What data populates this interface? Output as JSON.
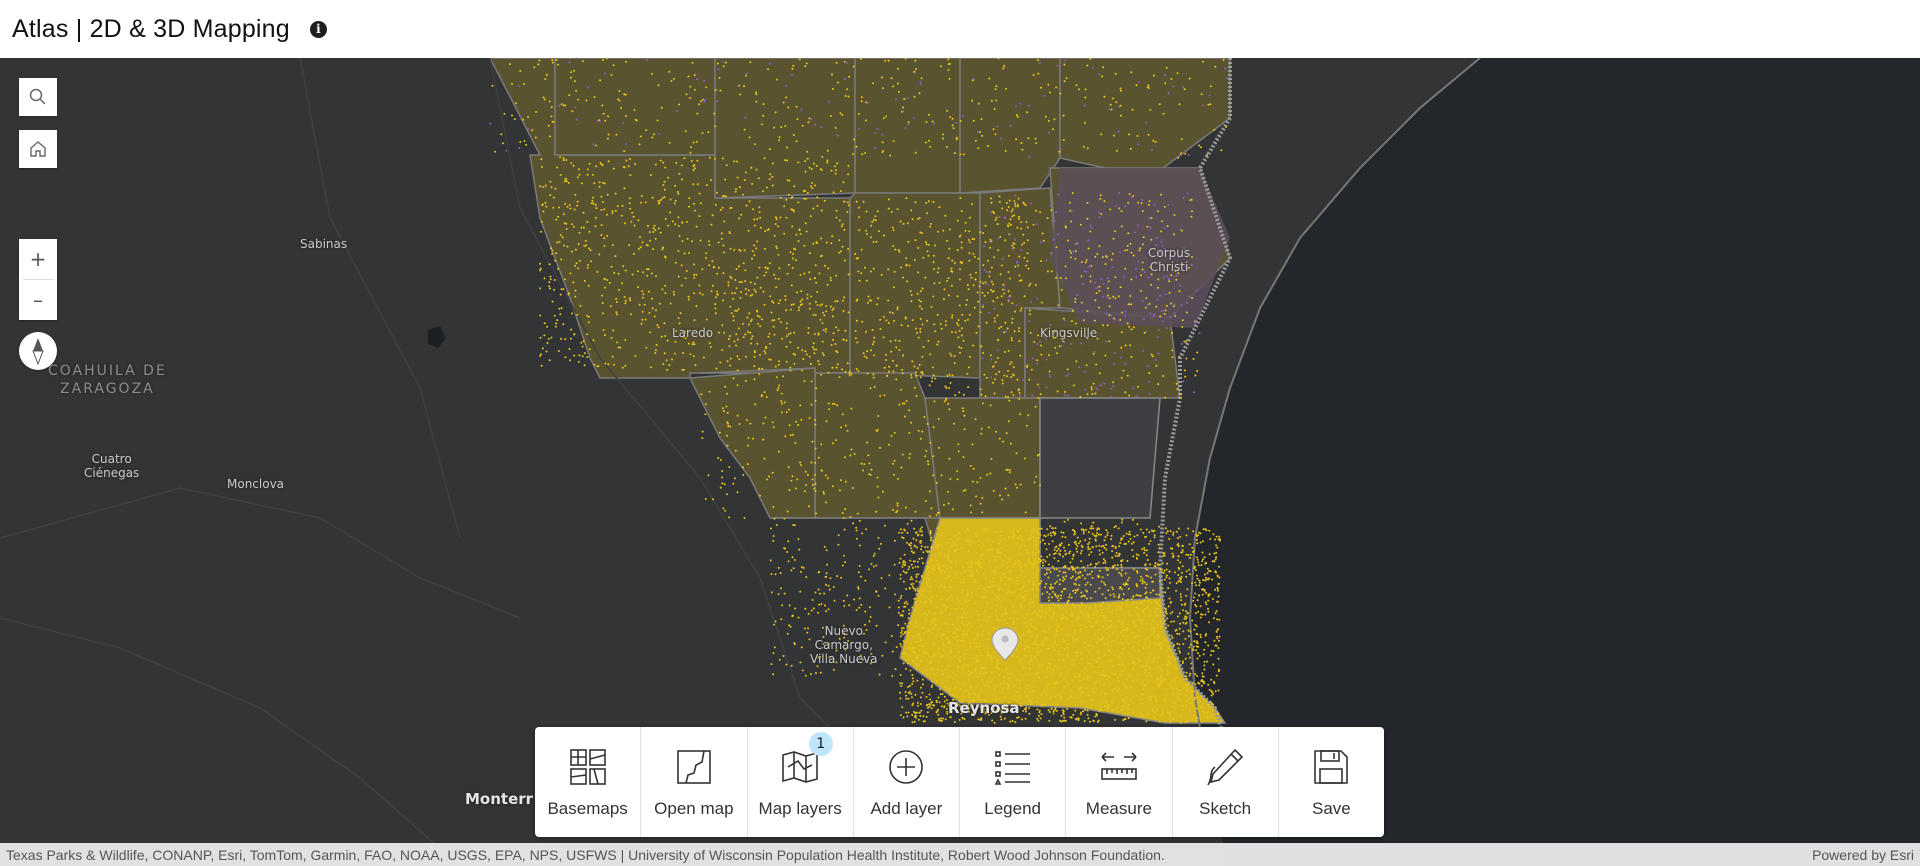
{
  "header": {
    "title": "Atlas | 2D & 3D Mapping",
    "info_icon": "info-icon"
  },
  "map": {
    "labels": {
      "sabinas": "Sabinas",
      "coahuila": "COAHUILA DE\nZARAGOZA",
      "cuatro": "Cuatro\nCiénegas",
      "monclova": "Monclova",
      "laredo": "Laredo",
      "corpus": "Corpus\nChristi",
      "kingsville": "Kingsville",
      "nuevo": "Nuevo\nCamargo,\nVilla Nueva",
      "reynosa": "Reynosa",
      "monterrey": "Monterr"
    },
    "colors": {
      "background": "#333436",
      "water": "#23272b",
      "dots": "#e8c51c",
      "dots_alt": "#8a5fc9"
    }
  },
  "controls": {
    "search": "search-icon",
    "home": "home-icon",
    "zoom_in": "+",
    "zoom_out": "–",
    "compass": "compass-icon"
  },
  "toolbar": {
    "items": [
      {
        "label": "Basemaps",
        "icon": "basemaps-icon"
      },
      {
        "label": "Open map",
        "icon": "open-map-icon"
      },
      {
        "label": "Map layers",
        "icon": "map-layers-icon",
        "badge": "1"
      },
      {
        "label": "Add layer",
        "icon": "add-layer-icon"
      },
      {
        "label": "Legend",
        "icon": "legend-icon"
      },
      {
        "label": "Measure",
        "icon": "measure-icon"
      },
      {
        "label": "Sketch",
        "icon": "sketch-icon"
      },
      {
        "label": "Save",
        "icon": "save-icon"
      }
    ]
  },
  "footer": {
    "attribution": "Texas Parks & Wildlife, CONANP, Esri, TomTom, Garmin, FAO, NOAA, USGS, EPA, NPS, USFWS | University of Wisconsin Population Health Institute, Robert Wood Johnson Foundation.",
    "powered_by": "Powered by Esri"
  }
}
